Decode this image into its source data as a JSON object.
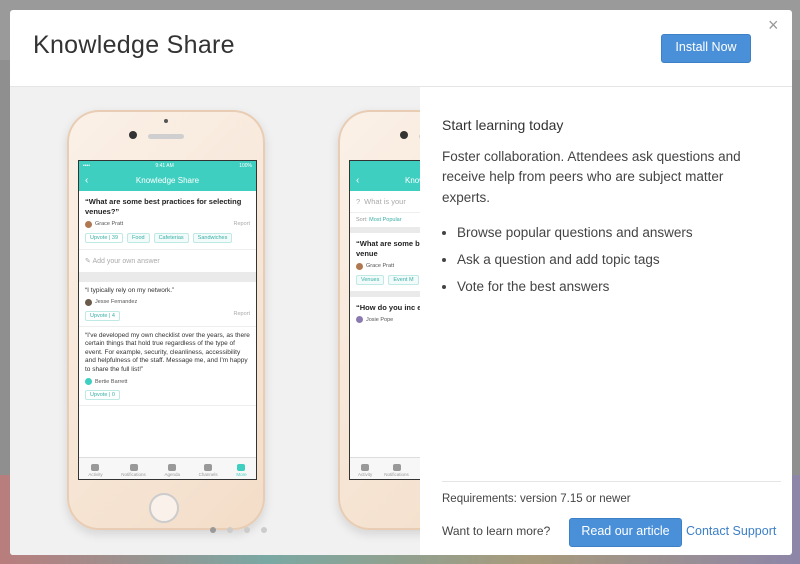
{
  "modal": {
    "title": "Knowledge Share",
    "install_label": "Install Now",
    "close_label": "×"
  },
  "phone1": {
    "status_left": "•••• ",
    "status_time": "9:41 AM",
    "status_right": "100%",
    "nav_title": "Knowledge Share",
    "question": "“What are some best practices for selecting venues?”",
    "author": "Grace Pratt",
    "report": "Report",
    "upvote": "Upvote | 39",
    "tags": [
      "Food",
      "Cafeterias",
      "Sandwiches"
    ],
    "answer_placeholder": "Add your own answer",
    "answers": [
      {
        "text": "“I typically rely on my network.”",
        "author": "Jesse Fernandez",
        "upvote": "Upvote | 4",
        "report": "Report"
      },
      {
        "text": "“I've developed my own checklist over the years, as there certain things that hold true regardless of the type of event. For example, security, cleanliness, accessibility and helpfulness of the staff. Message me, and I'm happy to share the full list!”",
        "author": "Bertie Barrett",
        "upvote": "Upvote | 0"
      }
    ],
    "tabs": [
      "Activity",
      "Notifications",
      "Agenda",
      "Channels",
      "More"
    ]
  },
  "phone2": {
    "nav_title": "Know",
    "search_placeholder": "What is your",
    "sort_label": "Sort: ",
    "sort_value": "Most Popular",
    "q1": "“What are some best practices for selecting venue",
    "q1_author": "Grace Pratt",
    "q1_tags": [
      "Venues",
      "Event M"
    ],
    "q2": "“How do you inc engagement?”",
    "q2_author": "Josie Pope",
    "tabs": [
      "Activity",
      "Notifications"
    ]
  },
  "right": {
    "title": "Start learning today",
    "description": "Foster collaboration. Attendees ask questions and receive help from peers who are subject matter experts.",
    "bullets": [
      "Browse popular questions and answers",
      "Ask a question and add topic tags",
      "Vote for the best answers"
    ],
    "requirements": "Requirements: version 7.15 or newer",
    "learn_more": "Want to learn more?",
    "read_article": "Read our article",
    "contact_support": "Contact Support"
  },
  "carousel": {
    "count": 4,
    "active_index": 0
  },
  "colors": {
    "accent": "#4a90d9",
    "teal": "#3ecfc0"
  }
}
